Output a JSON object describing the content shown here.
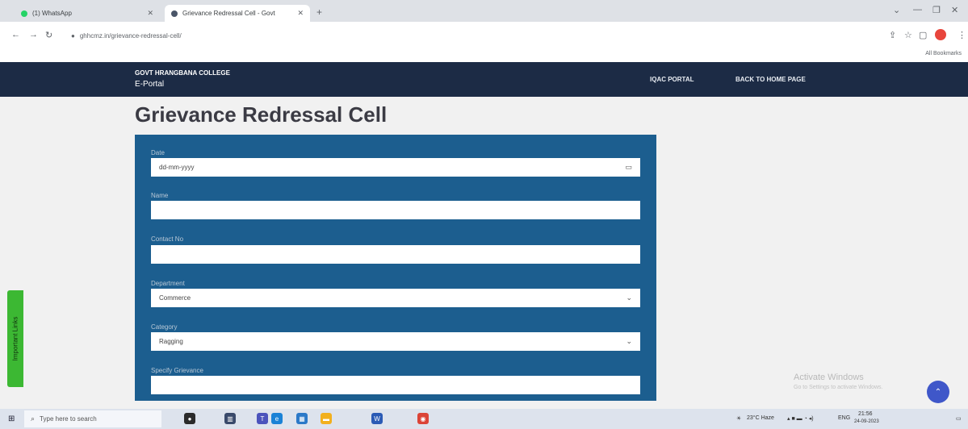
{
  "browser": {
    "tabs": [
      {
        "label": "(1) WhatsApp",
        "favicon_color": "#25d366"
      },
      {
        "label": "Grievance Redressal Cell - Govt",
        "favicon_color": "#4a5568"
      }
    ],
    "url": "ghhcmz.in/grievance-redressal-cell/",
    "bookmarks_label": "All Bookmarks"
  },
  "header": {
    "college": "GOVT HRANGBANA COLLEGE",
    "portal": "E-Portal",
    "nav": [
      {
        "label": "IQAC PORTAL"
      },
      {
        "label": "BACK TO HOME PAGE"
      }
    ]
  },
  "page": {
    "title": "Grievance Redressal Cell"
  },
  "form": {
    "date": {
      "label": "Date",
      "placeholder": "dd-mm-yyyy"
    },
    "name": {
      "label": "Name",
      "value": ""
    },
    "contact": {
      "label": "Contact No",
      "value": ""
    },
    "department": {
      "label": "Department",
      "value": "Commerce"
    },
    "category": {
      "label": "Category",
      "value": "Ragging"
    },
    "specific": {
      "label": "Specify Grievance",
      "value": ""
    }
  },
  "side_tab": {
    "label": "Important Links"
  },
  "watermark": {
    "line1": "Activate Windows",
    "line2": "Go to Settings to activate Windows."
  },
  "taskbar": {
    "search_placeholder": "Type here to search",
    "weather": "23°C Haze",
    "lang": "ENG",
    "time": "21:56",
    "date": "24-09-2023"
  },
  "colors": {
    "header_bg": "#1c2b45",
    "form_bg": "#1c5e8f",
    "side_tab": "#3cb833",
    "scroll_button": "#3f57c9"
  }
}
